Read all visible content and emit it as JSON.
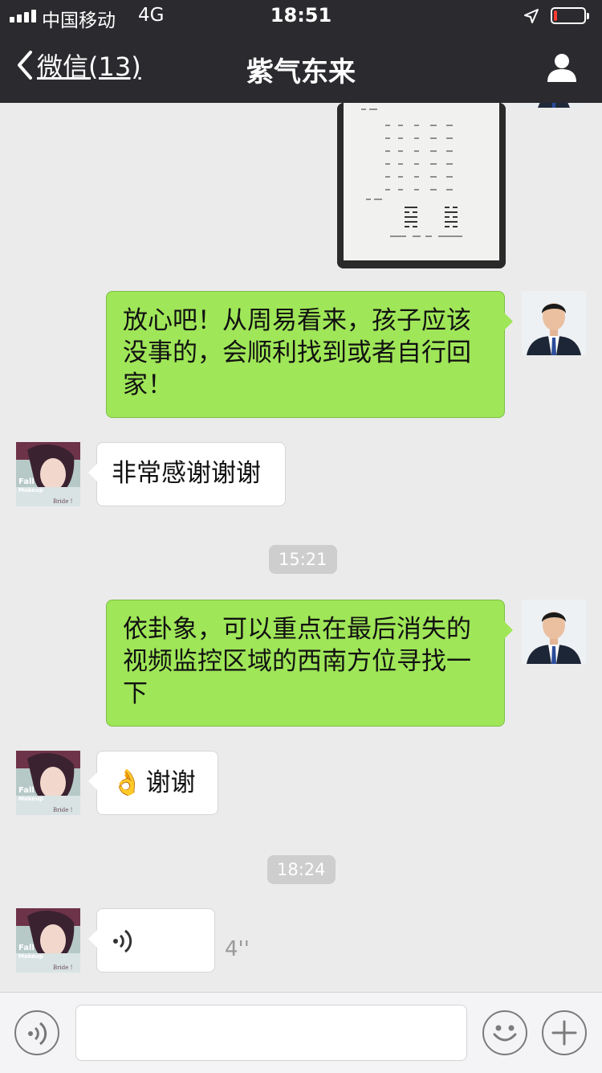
{
  "status_bar": {
    "carrier": "中国移动",
    "network": "4G",
    "time": "18:51",
    "battery_level": 0.1,
    "battery_color": "#ff3b30"
  },
  "nav": {
    "back_label": "微信(13)",
    "title": "紫气东来",
    "back_icon": "chevron-left-icon",
    "profile_icon": "person-icon"
  },
  "messages": [
    {
      "side": "right",
      "type": "image",
      "content": "hexagram worksheet photo"
    },
    {
      "side": "right",
      "type": "text",
      "text": "放心吧！从周易看来，孩子应该没事的，会顺利找到或者自行回家！"
    },
    {
      "side": "left",
      "type": "text",
      "text": "非常感谢谢谢"
    },
    {
      "type": "time",
      "text": "15:21"
    },
    {
      "side": "right",
      "type": "text",
      "text": "依卦象，可以重点在最后消失的视频监控区域的西南方位寻找一下"
    },
    {
      "side": "left",
      "type": "text",
      "emoji": "👌",
      "text": "谢谢"
    },
    {
      "type": "time",
      "text": "18:24"
    },
    {
      "side": "left",
      "type": "voice",
      "duration": "4''"
    }
  ],
  "avatar_text": {
    "line1": "Fall",
    "line2": "Makeup",
    "line3": "Bride !"
  },
  "input_bar": {
    "voice_icon": "voice-icon",
    "emoji_icon": "smiley-icon",
    "plus_icon": "plus-icon",
    "text_value": ""
  },
  "colors": {
    "nav_bg": "#2b2b2f",
    "bubble_green": "#9fe658",
    "chat_bg": "#ebebeb"
  }
}
